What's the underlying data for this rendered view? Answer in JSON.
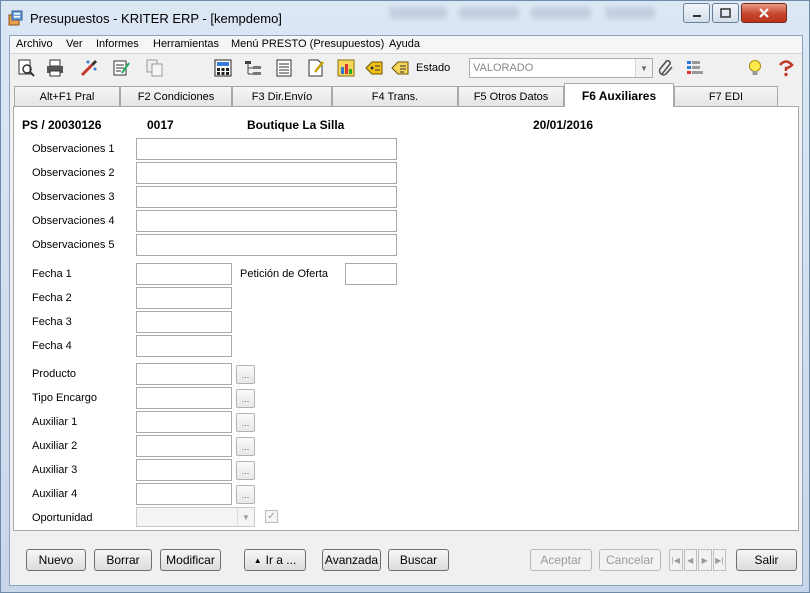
{
  "window": {
    "title": "Presupuestos - KRITER ERP - [kempdemo]"
  },
  "menu": [
    "Archivo",
    "Ver",
    "Informes",
    "Herramientas",
    "Menú PRESTO (Presupuestos)",
    "Ayuda"
  ],
  "toolbar": {
    "estado_label": "Estado",
    "estado_value": "VALORADO",
    "icons": [
      "preview-icon",
      "print-icon",
      "magic-wand-icon",
      "edit-document-icon",
      "copy-icon",
      "calculator-icon",
      "tree-icon",
      "list-icon",
      "document-edit-icon",
      "chart-icon",
      "tag-icon",
      "report-icon",
      "paperclip-icon",
      "grid-icon",
      "lightbulb-icon",
      "help-icon"
    ]
  },
  "tabs": [
    "Alt+F1 Pral",
    "F2 Condiciones",
    "F3 Dir.Envío",
    "F4 Trans.",
    "F5 Otros Datos",
    "F6 Auxiliares",
    "F7 EDI"
  ],
  "active_tab": "F6 Auxiliares",
  "header": {
    "doc": "PS / 20030126",
    "code": "0017",
    "client": "Boutique La Silla",
    "date": "20/01/2016"
  },
  "fields": {
    "observaciones_1": "Observaciones 1",
    "observaciones_2": "Observaciones 2",
    "observaciones_3": "Observaciones 3",
    "observaciones_4": "Observaciones 4",
    "observaciones_5": "Observaciones 5",
    "fecha_1": "Fecha 1",
    "peticion_oferta": "Petición de Oferta",
    "fecha_2": "Fecha 2",
    "fecha_3": "Fecha 3",
    "fecha_4": "Fecha 4",
    "producto": "Producto",
    "tipo_encargo": "Tipo Encargo",
    "auxiliar_1": "Auxiliar 1",
    "auxiliar_2": "Auxiliar 2",
    "auxiliar_3": "Auxiliar 3",
    "auxiliar_4": "Auxiliar 4",
    "oportunidad": "Oportunidad",
    "lookup_button": "..."
  },
  "buttons": {
    "nuevo": "Nuevo",
    "borrar": "Borrar",
    "modificar": "Modificar",
    "ir_a": "Ir a ...",
    "avanzada": "Avanzada",
    "buscar": "Buscar",
    "aceptar": "Aceptar",
    "cancelar": "Cancelar",
    "salir": "Salir"
  }
}
